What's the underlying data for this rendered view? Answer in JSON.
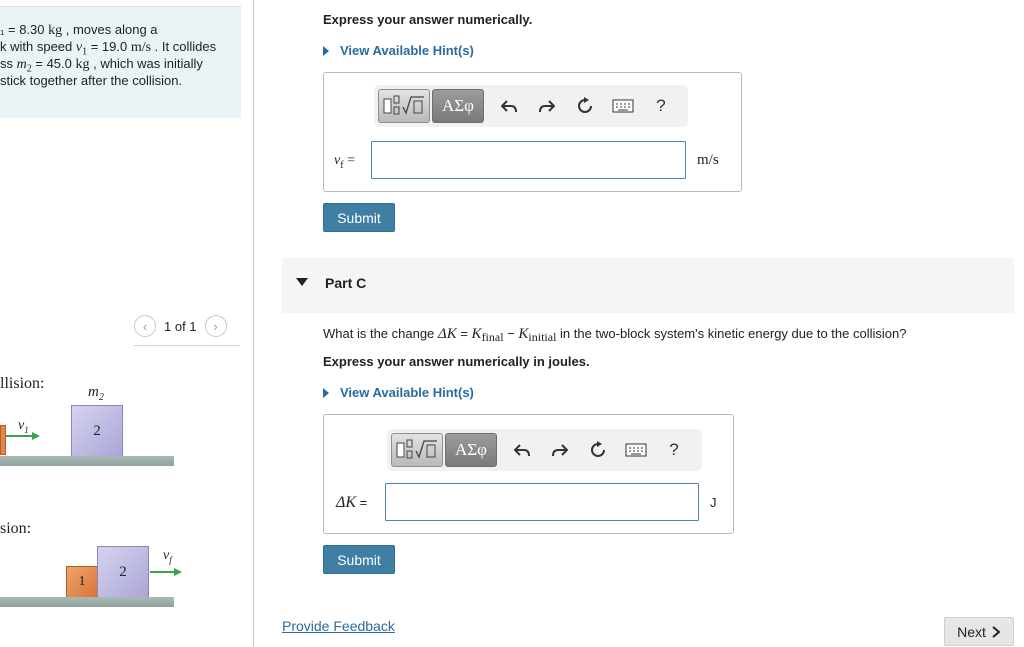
{
  "problem": {
    "line1": {
      "prefix": "₁ = 8.30 ",
      "unit": "kg",
      "suffix": " , moves along a"
    },
    "line2": {
      "prefix": "k with speed ",
      "var": "v",
      "sub": "1",
      "eq": " = 19.0 ",
      "unit": "m/s",
      "suffix": " . It collides"
    },
    "line3": {
      "prefix": "ss ",
      "var": "m",
      "sub": "2",
      "eq": " = 45.0 ",
      "unit": "kg",
      "suffix": " , which was initially"
    },
    "line4": "stick together after the collision."
  },
  "figure_pager": {
    "label": "1 of 1",
    "prev_icon": "chevron-left-icon",
    "next_icon": "chevron-right-icon"
  },
  "figure": {
    "before_label": "llision:",
    "after_label": "sion:",
    "m2_label": "m",
    "m2_sub": "2",
    "v1_label": "v",
    "v1_sub": "1",
    "vf_label": "v",
    "vf_sub": "f",
    "block1": "1",
    "block2": "2"
  },
  "part_b": {
    "instruction": "Express your answer numerically.",
    "hint": "View Available Hint(s)",
    "toolbar": {
      "greek": "ΑΣφ",
      "help": "?"
    },
    "answer_label": "v",
    "answer_sub": "f",
    "answer_eq": " =",
    "answer_value": "",
    "unit": "m/s",
    "submit": "Submit"
  },
  "part_c": {
    "title": "Part C",
    "question_pre": "What is the change ",
    "question_math": "ΔK",
    "question_eq": " = ",
    "k_final": "K",
    "final_sub": "final",
    "minus": " − ",
    "k_initial": "K",
    "initial_sub": "initial",
    "question_post": " in the two-block system's kinetic energy due to the collision?",
    "instruction": "Express your answer numerically in joules.",
    "hint": "View Available Hint(s)",
    "toolbar": {
      "greek": "ΑΣφ",
      "help": "?"
    },
    "answer_label": "ΔK",
    "answer_eq": " =",
    "answer_value": "",
    "unit": "J",
    "submit": "Submit"
  },
  "footer": {
    "feedback": "Provide Feedback",
    "next": "Next"
  },
  "colors": {
    "accent": "#3f7fa4",
    "link": "#2a6b9e",
    "problem_bg": "#eaf4f7",
    "block1": "#e2874a",
    "block2": "#b9b6e0"
  }
}
